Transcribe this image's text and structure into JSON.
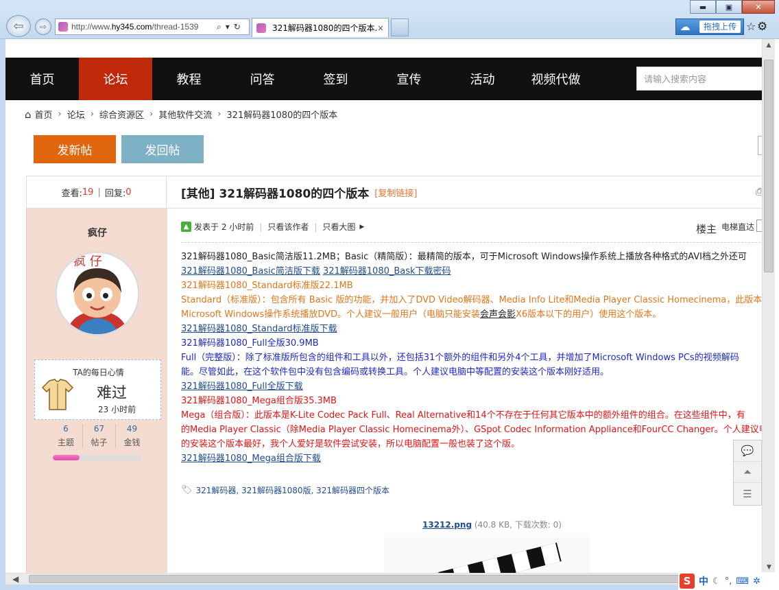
{
  "browser": {
    "url_prefix": "http://www.",
    "url_domain": "hy345.com",
    "url_rest": "/thread-1539",
    "tab_title": "321解码器1080的四个版本...",
    "tab_close": "×",
    "cloud_label": "拖拽上传",
    "minimize": "▬",
    "maximize": "▣",
    "close": "✕"
  },
  "nav": {
    "items": [
      "首页",
      "论坛",
      "教程",
      "问答",
      "签到",
      "宣传",
      "活动",
      "视频代做"
    ],
    "active_index": 1,
    "search_placeholder": "请输入搜索内容"
  },
  "breadcrumb": [
    "首页",
    "论坛",
    "综合资源区",
    "其他软件交流",
    "321解码器1080的四个版本"
  ],
  "buttons": {
    "new_thread": "发新帖",
    "reply": "发回帖"
  },
  "thread": {
    "views_label": "查看:",
    "views": "19",
    "replies_label": "回复:",
    "replies": "0",
    "title": "[其他] 321解码器1080的四个版本",
    "copy_link": "[复制链接]"
  },
  "author": {
    "name": "疯仔",
    "avatar_text": "疯 仔",
    "mood_title": "TA的每日心情",
    "mood": "难过",
    "mood_time": "23 小时前",
    "stats": [
      {
        "value": "6",
        "label": "主题"
      },
      {
        "value": "67",
        "label": "帖子"
      },
      {
        "value": "49",
        "label": "金钱"
      }
    ],
    "level_progress": 0.3
  },
  "post": {
    "posted": "发表于 2 小时前",
    "only_author": "只看该作者",
    "big_image": "只看大图",
    "floor": "楼主",
    "elevator": "电梯直达",
    "lines": [
      {
        "style": "black",
        "text": "321解码器1080_Basic简洁版11.2MB；Basic（精简版）：最精简的版本，可于Microsoft Windows操作系统上播放各种格式的AVI档之外还可"
      },
      {
        "style": "links",
        "parts": [
          "321解码器1080_Basic简洁版下载",
          "321解码器1080_Bask下载密码"
        ]
      },
      {
        "style": "orange",
        "text": "321解码器1080_Standard标准版22.1MB"
      },
      {
        "style": "orange",
        "text": "Standard（标准版）：包含所有 Basic 版的功能，并加入了DVD Video解码器、Media Info Lite和Media Player Classic Homecinema，此版本"
      },
      {
        "style": "orange-u",
        "before": "Microsoft Windows操作系统播放DVD。个人建议一般用户（电脑只能安装",
        "under": "会声会影",
        "after": "X6版本以下的用户）使用这个版本。"
      },
      {
        "style": "link",
        "text": "321解码器1080_Standard标准版下载"
      },
      {
        "style": "blue",
        "text": "321解码器1080_Full全版30.9MB"
      },
      {
        "style": "blue",
        "text": "Full（完整版）：除了标准版所包含的组件和工具以外，还包括31个额外的组件和另外4个工具，并增加了Microsoft Windows PCs的视频解码"
      },
      {
        "style": "blue",
        "text": "能。尽管如此，在这个软件包中没有包含编码或转换工具。个人建议电脑中等配置的安装这个版本刚好适用。"
      },
      {
        "style": "link",
        "text": "321解码器1080_Full全版下载"
      },
      {
        "style": "red",
        "text": "321解码器1080_Mega组合版35.3MB"
      },
      {
        "style": "red",
        "text": "Mega（组合版）：此版本是K-Lite Codec Pack Full、Real Alternative和14个不存在于任何其它版本中的额外组件的组合。在这些组件中，有"
      },
      {
        "style": "red",
        "text": "的Media Player Classic（除Media Player Classic Homecinema外）、GSpot Codec Information Appliance和FourCC Changer。个人建议电脑"
      },
      {
        "style": "red",
        "text": "的安装这个版本最好，我个人爱好是软件尝试安装，所以电脑配置一般也装了这个版。"
      },
      {
        "style": "link",
        "text": "321解码器1080_Mega组合版下载"
      }
    ],
    "tags": "321解码器, 321解码器1080版, 321解码器四个版本",
    "attachment_name": "13212.png",
    "attachment_info": "(40.8 KB, 下载次数: 0)"
  },
  "ime": {
    "logo": "S",
    "lang": "中"
  }
}
